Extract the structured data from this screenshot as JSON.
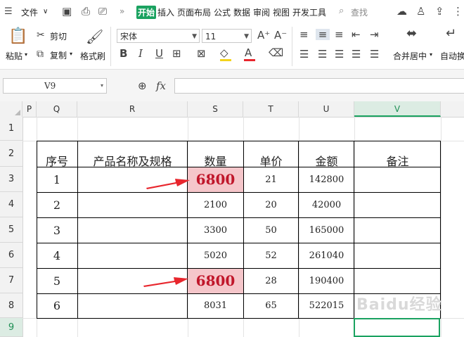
{
  "menubar": {
    "items": [
      "文件",
      "开始",
      "插入",
      "页面布局",
      "公式",
      "数据",
      "审阅",
      "视图",
      "开发工具"
    ],
    "search": "查找"
  },
  "ribbon": {
    "paste": "粘贴",
    "cut": "剪切",
    "copy": "复制",
    "format_painter": "格式刷",
    "font_name": "宋体",
    "font_size": "11",
    "merge_center": "合并居中",
    "auto_wrap": "自动换"
  },
  "formula_bar": {
    "name_box": "V9",
    "fx": "fx"
  },
  "columns": [
    "P",
    "Q",
    "R",
    "S",
    "T",
    "U",
    "V"
  ],
  "selected_column": "V",
  "rows": [
    "1",
    "2",
    "3",
    "4",
    "5",
    "6",
    "7",
    "8",
    "9"
  ],
  "selected_row": "9",
  "table": {
    "headers": [
      "序号",
      "产品名称及规格",
      "数量",
      "单价",
      "金额",
      "备注"
    ],
    "rows": [
      {
        "no": "1",
        "qty": "6800",
        "price": "21",
        "amount": "142800"
      },
      {
        "no": "2",
        "qty": "2100",
        "price": "20",
        "amount": "42000"
      },
      {
        "no": "3",
        "qty": "3300",
        "price": "50",
        "amount": "165000"
      },
      {
        "no": "4",
        "qty": "5020",
        "price": "52",
        "amount": "261040"
      },
      {
        "no": "5",
        "qty": "6800",
        "price": "28",
        "amount": "190400"
      },
      {
        "no": "6",
        "qty": "8031",
        "price": "65",
        "amount": "522015"
      }
    ]
  },
  "colors": {
    "accent": "#1aa260",
    "highlight_fill": "#f5c6ca",
    "highlight_text": "#c0162a",
    "arrow": "#e8262d"
  },
  "watermark": "Baidu经验"
}
